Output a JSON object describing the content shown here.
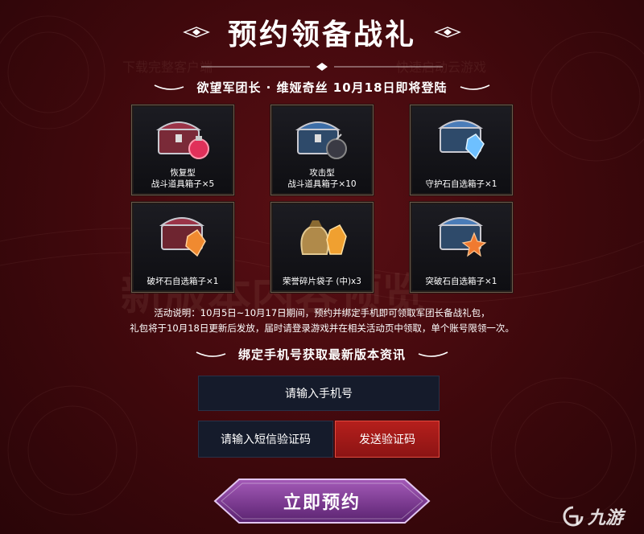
{
  "header": {
    "title": "预约领备战礼",
    "subtitle": "欲望军团长 · 维娅奇丝 10月18日即将登陆"
  },
  "rewards": [
    {
      "label_line1": "恢复型",
      "label_line2": "战斗道具箱子×5",
      "icon": "red-chest-with-potion-icon",
      "accent": "#d02a4a"
    },
    {
      "label_line1": "攻击型",
      "label_line2": "战斗道具箱子×10",
      "icon": "blue-chest-with-bomb-icon",
      "accent": "#3d6ea8"
    },
    {
      "label_line1": "",
      "label_line2": "守护石自选箱子×1",
      "icon": "blue-chest-with-crystal-icon",
      "accent": "#4aa0e0"
    },
    {
      "label_line1": "",
      "label_line2": "破坏石自选箱子×1",
      "icon": "red-chest-with-orange-crystal-icon",
      "accent": "#e0702a"
    },
    {
      "label_line1": "",
      "label_line2": "荣誉碎片袋子 (中)x3",
      "icon": "shard-pouch-icon",
      "accent": "#e8a030"
    },
    {
      "label_line1": "",
      "label_line2": "突破石自选箱子×1",
      "icon": "blue-chest-with-star-crystal-icon",
      "accent": "#e07a30"
    }
  ],
  "description": {
    "line1": "活动说明：10月5日~10月17日期间，预约并绑定手机即可领取军团长备战礼包，",
    "line2": "礼包将于10月18日更新后发放，届时请登录游戏并在相关活动页中领取，单个账号限领一次。"
  },
  "bind_section": {
    "heading": "绑定手机号获取最新版本资讯",
    "phone_placeholder": "请输入手机号",
    "code_placeholder": "请输入短信验证码",
    "send_code_label": "发送验证码",
    "reserve_label": "立即预约"
  },
  "watermark": {
    "text": "九游"
  },
  "background_ghost_text": {
    "left_top": "下载完整客户端",
    "right_top": "快速启动云游戏",
    "center": "新版本内容预览"
  },
  "colors": {
    "background": "#3e080c",
    "send_button": "#a51a18",
    "input_bg": "#151b2b",
    "reserve_button": "#7a3a8e"
  }
}
